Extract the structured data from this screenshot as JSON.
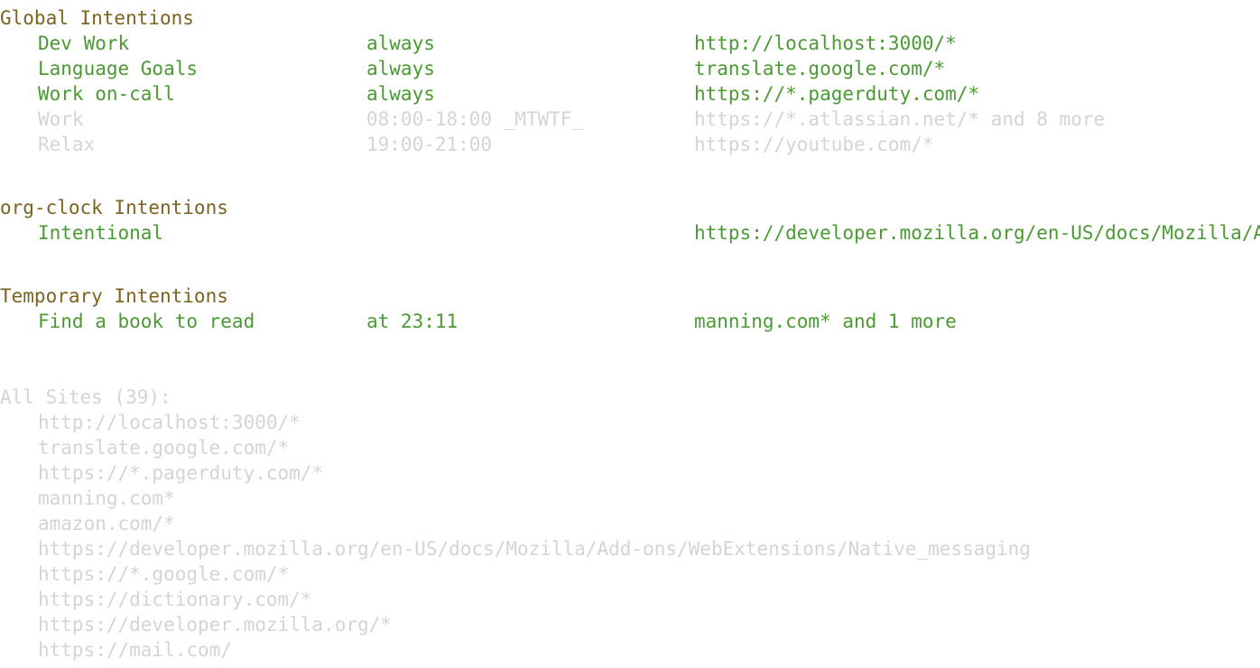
{
  "colors": {
    "background": "#ffffff",
    "section_heading": "#7d6322",
    "enabled_text": "#4a9a32",
    "disabled_text": "#d4d4d4"
  },
  "sections": {
    "global": {
      "title": "Global Intentions",
      "rows": [
        {
          "name": "Dev Work",
          "schedule": "always",
          "url": "http://localhost:3000/*",
          "enabled": true
        },
        {
          "name": "Language Goals",
          "schedule": "always",
          "url": "translate.google.com/*",
          "enabled": true
        },
        {
          "name": "Work on-call",
          "schedule": "always",
          "url": "https://*.pagerduty.com/*",
          "enabled": true
        },
        {
          "name": "Work",
          "schedule": "08:00-18:00 _MTWTF_",
          "url": "https://*.atlassian.net/* and 8 more",
          "enabled": false
        },
        {
          "name": "Relax",
          "schedule": "19:00-21:00",
          "url": "https://youtube.com/*",
          "enabled": false
        }
      ]
    },
    "orgclock": {
      "title": "org-clock Intentions",
      "rows": [
        {
          "name": "Intentional",
          "schedule": "",
          "url": "https://developer.mozilla.org/en-US/docs/Mozilla/Add-ons/WebExtensions/Native_messaging",
          "enabled": true
        }
      ]
    },
    "temporary": {
      "title": "Temporary Intentions",
      "rows": [
        {
          "name": "Find a book to read",
          "schedule": "at 23:11",
          "url": "manning.com* and 1 more",
          "enabled": true
        }
      ]
    }
  },
  "all_sites": {
    "label": "All Sites (39):",
    "count": 39,
    "sites": [
      "http://localhost:3000/*",
      "translate.google.com/*",
      "https://*.pagerduty.com/*",
      "manning.com*",
      "amazon.com/*",
      "https://developer.mozilla.org/en-US/docs/Mozilla/Add-ons/WebExtensions/Native_messaging",
      "https://*.google.com/*",
      "https://dictionary.com/*",
      "https://developer.mozilla.org/*",
      "https://mail.com/"
    ]
  }
}
